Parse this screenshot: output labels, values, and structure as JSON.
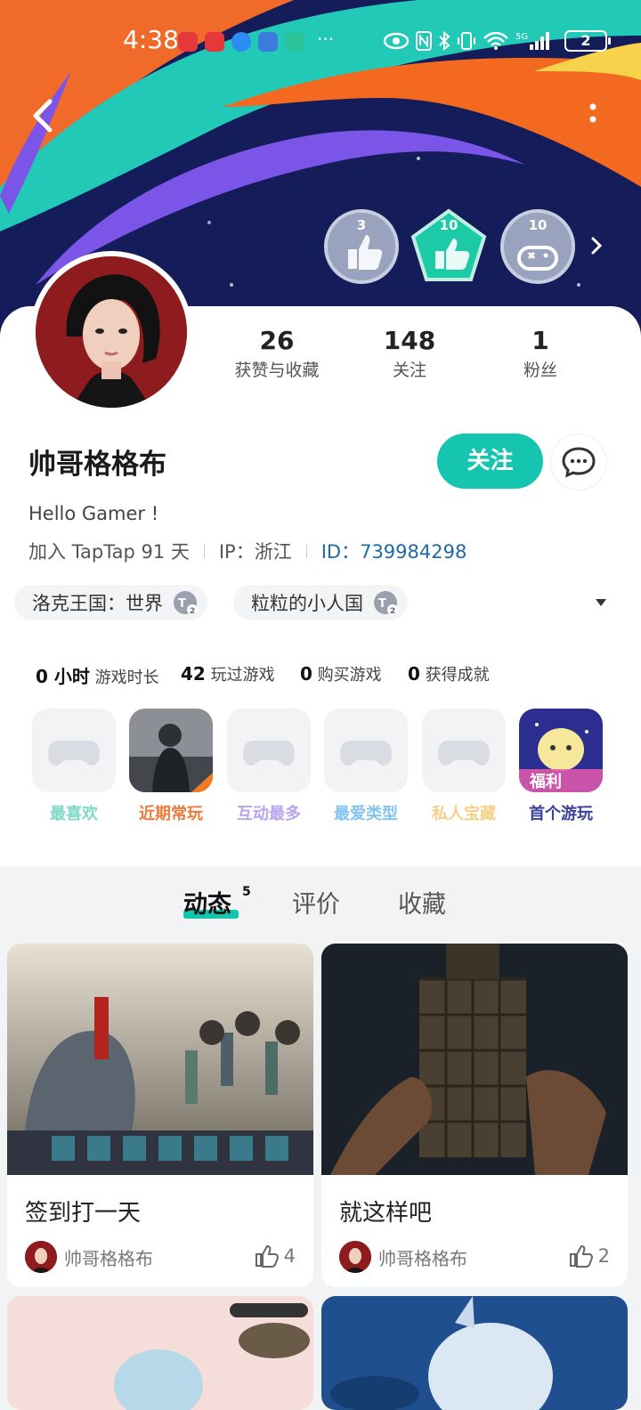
{
  "status_bar": {
    "time": "4:38",
    "battery": "2"
  },
  "badges": [
    {
      "value": "3"
    },
    {
      "value": "10"
    },
    {
      "value": "10"
    }
  ],
  "profile": {
    "name": "帅哥格格布",
    "bio": "Hello Gamer !",
    "join_info": "加入 TapTap 91 天",
    "ip": "IP：浙江",
    "id": "ID：739984298",
    "follow_label": "关注"
  },
  "stats": [
    {
      "value": "26",
      "label": "获赞与收藏"
    },
    {
      "value": "148",
      "label": "关注"
    },
    {
      "value": "1",
      "label": "粉丝"
    }
  ],
  "game_chips": [
    {
      "label": "洛克王国：世界"
    },
    {
      "label": "粒粒的小人国"
    }
  ],
  "game_stats": [
    {
      "value": "0 小时",
      "label": "游戏时长"
    },
    {
      "value": "42",
      "label": "玩过游戏"
    },
    {
      "value": "0",
      "label": "购买游戏"
    },
    {
      "value": "0",
      "label": "获得成就"
    }
  ],
  "game_tiles": [
    {
      "label": "最喜欢",
      "color": "#7fd8c8"
    },
    {
      "label": "近期常玩",
      "color": "#f07a3c"
    },
    {
      "label": "互动最多",
      "color": "#b7a6ef"
    },
    {
      "label": "最爱类型",
      "color": "#82c4f2"
    },
    {
      "label": "私人宝藏",
      "color": "#f6cf8a"
    },
    {
      "label": "首个游玩",
      "color": "#3b3f9c"
    }
  ],
  "tile_texts": {
    "welfare": "福利"
  },
  "tabs": [
    {
      "label": "动态",
      "count": "5"
    },
    {
      "label": "评价"
    },
    {
      "label": "收藏"
    }
  ],
  "posts": [
    {
      "title": "签到打一天",
      "author": "帅哥格格布",
      "likes": "4"
    },
    {
      "title": "就这样吧",
      "author": "帅哥格格布",
      "likes": "2"
    }
  ],
  "colors": {
    "accent": "#15c5b0",
    "id_link": "#1d6aa7"
  }
}
